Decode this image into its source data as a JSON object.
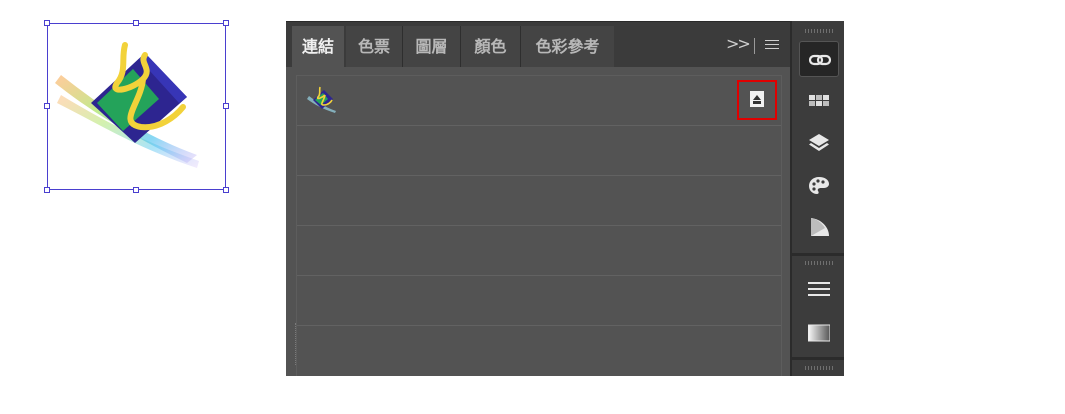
{
  "panel": {
    "tabs": [
      {
        "label": "連結",
        "active": true
      },
      {
        "label": "色票",
        "active": false
      },
      {
        "label": "圖層",
        "active": false
      },
      {
        "label": "顏色",
        "active": false
      },
      {
        "label": "色彩參考",
        "active": false
      }
    ],
    "overflow_label": ">>",
    "menu_icon": "hamburger-menu-icon"
  },
  "links": {
    "rows": [
      {
        "thumbnail": "artwork-thumbnail",
        "badge": "embed-link-icon",
        "highlighted": true
      },
      {},
      {},
      {},
      {},
      {}
    ]
  },
  "dock": {
    "icons": [
      "links-icon",
      "swatches-icon",
      "layers-icon",
      "color-palette-icon",
      "color-guide-icon",
      "stroke-icon",
      "gradient-icon"
    ],
    "active": "links-icon"
  },
  "colors": {
    "panel_bg": "#535353",
    "tab_active": "#535353",
    "tab_inactive": "#444444",
    "dock_bg": "#3c3c3c",
    "selection": "#4a3fcf",
    "highlight": "#e00000"
  }
}
